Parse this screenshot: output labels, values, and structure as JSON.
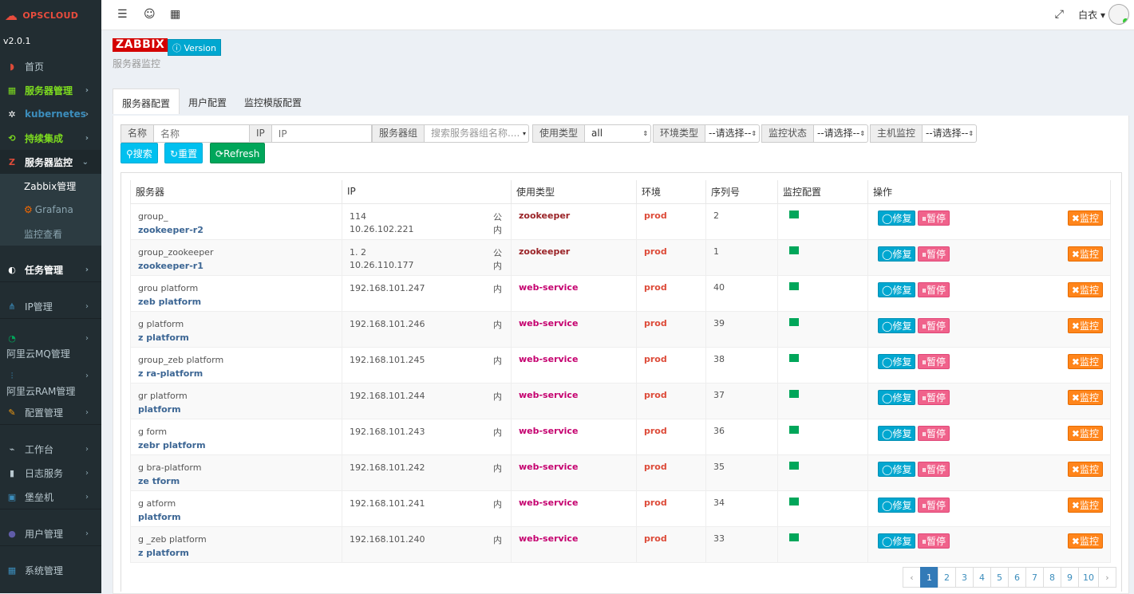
{
  "app": {
    "logo": "OPSCLOUD",
    "version": "v2.0.1"
  },
  "sidebar": {
    "items": [
      {
        "label": "首页",
        "icon": "dashboard-icon"
      },
      {
        "label": "服务器管理",
        "icon": "server-icon"
      },
      {
        "label": "kubernetes",
        "icon": "kubernetes-icon"
      },
      {
        "label": "持续集成",
        "icon": "ci-icon"
      },
      {
        "label": "服务器监控",
        "icon": "zabbix-icon"
      },
      {
        "label": "任务管理",
        "icon": "task-icon"
      },
      {
        "label": "IP管理",
        "icon": "network-icon"
      },
      {
        "label": "阿里云MQ管理",
        "icon": "mq-icon"
      },
      {
        "label": "阿里云RAM管理",
        "icon": "ram-icon"
      },
      {
        "label": "配置管理",
        "icon": "config-icon"
      },
      {
        "label": "工作台",
        "icon": "workbench-icon"
      },
      {
        "label": "日志服务",
        "icon": "log-icon"
      },
      {
        "label": "堡垒机",
        "icon": "bastion-icon"
      },
      {
        "label": "用户管理",
        "icon": "user-icon"
      },
      {
        "label": "系统管理",
        "icon": "system-icon"
      }
    ],
    "sub": [
      {
        "label": "Zabbix管理"
      },
      {
        "label": "Grafana"
      },
      {
        "label": "监控查看"
      }
    ]
  },
  "topbar": {
    "user": "白衣 ▾"
  },
  "page": {
    "badge": "ZABBIX",
    "version_btn": "Version",
    "subtitle": "服务器监控"
  },
  "tabs": [
    "服务器配置",
    "用户配置",
    "监控模版配置"
  ],
  "filters": {
    "name_label": "名称",
    "name_placeholder": "名称",
    "ip_label": "IP",
    "ip_placeholder": "IP",
    "group_label": "服务器组",
    "group_placeholder": "搜索服务器组名称....",
    "type_label": "使用类型",
    "type_value": "all",
    "env_label": "环境类型",
    "env_value": "--请选择--",
    "mon_label": "监控状态",
    "mon_value": "--请选择--",
    "host_label": "主机监控",
    "host_value": "--请选择--"
  },
  "buttons": {
    "search": "搜索",
    "reset": "重置",
    "refresh": "Refresh"
  },
  "table": {
    "headers": [
      "服务器",
      "IP",
      "使用类型",
      "环境",
      "序列号",
      "监控配置",
      "操作"
    ],
    "actions": {
      "fix": "修复",
      "pause": "暂停",
      "monitor": "监控"
    },
    "rows": [
      {
        "group": "group_",
        "host": "zookeeper-r2",
        "ip1": "114",
        "ip2": "10.26.102.221",
        "t1": "公",
        "t2": "内",
        "type": "zookeeper",
        "cls": "zk",
        "env": "prod",
        "seq": "2"
      },
      {
        "group": "group_zookeeper",
        "host": "zookeeper-r1",
        "ip1": "1.  2",
        "ip2": "10.26.110.177",
        "t1": "公",
        "t2": "内",
        "type": "zookeeper",
        "cls": "zk",
        "env": "prod",
        "seq": "1"
      },
      {
        "group": "grou  platform",
        "host": "zeb  platform",
        "ip1": "192.168.101.247",
        "ip2": "",
        "t1": "内",
        "t2": "",
        "type": "web-service",
        "cls": "web",
        "env": "prod",
        "seq": "40"
      },
      {
        "group": "g  platform",
        "host": "z  platform",
        "ip1": "192.168.101.246",
        "ip2": "",
        "t1": "内",
        "t2": "",
        "type": "web-service",
        "cls": "web",
        "env": "prod",
        "seq": "39"
      },
      {
        "group": "group_zeb  platform",
        "host": "z  ra-platform",
        "ip1": "192.168.101.245",
        "ip2": "",
        "t1": "内",
        "t2": "",
        "type": "web-service",
        "cls": "web",
        "env": "prod",
        "seq": "38"
      },
      {
        "group": "gr  platform",
        "host": "  platform",
        "ip1": "192.168.101.244",
        "ip2": "",
        "t1": "内",
        "t2": "",
        "type": "web-service",
        "cls": "web",
        "env": "prod",
        "seq": "37"
      },
      {
        "group": "g  form",
        "host": "zebr  platform",
        "ip1": "192.168.101.243",
        "ip2": "",
        "t1": "内",
        "t2": "",
        "type": "web-service",
        "cls": "web",
        "env": "prod",
        "seq": "36"
      },
      {
        "group": "g  bra-platform",
        "host": "ze  tform",
        "ip1": "192.168.101.242",
        "ip2": "",
        "t1": "内",
        "t2": "",
        "type": "web-service",
        "cls": "web",
        "env": "prod",
        "seq": "35"
      },
      {
        "group": "g  atform",
        "host": "  platform",
        "ip1": "192.168.101.241",
        "ip2": "",
        "t1": "内",
        "t2": "",
        "type": "web-service",
        "cls": "web",
        "env": "prod",
        "seq": "34"
      },
      {
        "group": "g  _zeb  platform",
        "host": "z  platform",
        "ip1": "192.168.101.240",
        "ip2": "",
        "t1": "内",
        "t2": "",
        "type": "web-service",
        "cls": "web",
        "env": "prod",
        "seq": "33"
      }
    ]
  },
  "pagination": {
    "prev": "‹",
    "pages": [
      "1",
      "2",
      "3",
      "4",
      "5",
      "6",
      "7",
      "8",
      "9",
      "10"
    ],
    "next": "›",
    "current": "1"
  }
}
